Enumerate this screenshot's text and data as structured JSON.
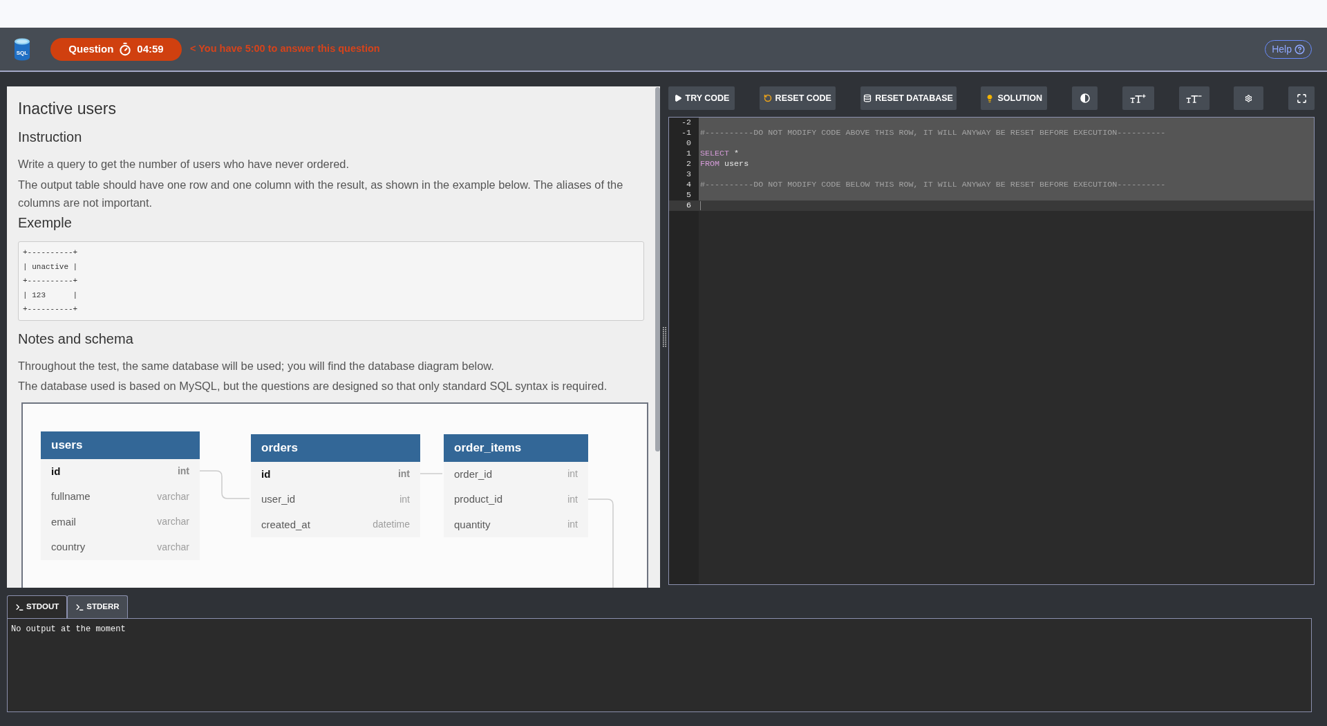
{
  "header": {
    "logo": "SQL",
    "timer": {
      "label": "Question",
      "time": "04:59"
    },
    "notice": "< You have 5:00 to answer this question",
    "help": "Help"
  },
  "problem": {
    "title": "Inactive users",
    "instruction_heading": "Instruction",
    "instruction": [
      "Write a query to get the number of users who have never ordered.",
      "The output table should have one row and one column with the result, as shown in the example below. The aliases of the columns are not important."
    ],
    "example_heading": "Exemple",
    "example": [
      "+----------+",
      "| unactive |",
      "+----------+",
      "| 123      |",
      "+----------+"
    ],
    "notes_heading": "Notes and schema",
    "notes": [
      "Throughout the test, the same database will be used; you will find the database diagram below.",
      "The database used is based on MySQL, but the questions are designed so that only standard SQL syntax is required."
    ],
    "schema": {
      "tables": [
        {
          "name": "users",
          "columns": [
            {
              "name": "id",
              "type": "int",
              "primary": true
            },
            {
              "name": "fullname",
              "type": "varchar",
              "primary": false
            },
            {
              "name": "email",
              "type": "varchar",
              "primary": false
            },
            {
              "name": "country",
              "type": "varchar",
              "primary": false
            }
          ]
        },
        {
          "name": "orders",
          "columns": [
            {
              "name": "id",
              "type": "int",
              "primary": true
            },
            {
              "name": "user_id",
              "type": "int",
              "primary": false
            },
            {
              "name": "created_at",
              "type": "datetime",
              "primary": false
            }
          ]
        },
        {
          "name": "order_items",
          "columns": [
            {
              "name": "order_id",
              "type": "int",
              "primary": false
            },
            {
              "name": "product_id",
              "type": "int",
              "primary": false
            },
            {
              "name": "quantity",
              "type": "int",
              "primary": false
            }
          ]
        }
      ]
    }
  },
  "toolbar": [
    {
      "kind": "try",
      "label": "TRY CODE"
    },
    {
      "kind": "reset_code",
      "label": "RESET CODE"
    },
    {
      "kind": "reset_db",
      "label": "RESET DATABASE"
    },
    {
      "kind": "solution",
      "label": "SOLUTION"
    },
    {
      "kind": "contrast"
    },
    {
      "kind": "font_up"
    },
    {
      "kind": "font_down"
    },
    {
      "kind": "settings"
    },
    {
      "kind": "fullscreen"
    }
  ],
  "editor": {
    "lines": [
      {
        "number": "-2",
        "readonly": true,
        "current": false
      },
      {
        "number": "-1",
        "readonly": true,
        "current": false,
        "tokens": [
          {
            "kind": "comment",
            "text": "#----------DO NOT MODIFY CODE ABOVE THIS ROW, IT WILL ANYWAY BE RESET BEFORE EXECUTION----------"
          }
        ]
      },
      {
        "number": "0",
        "readonly": true,
        "current": false
      },
      {
        "number": "1",
        "readonly": true,
        "current": false,
        "tokens": [
          {
            "kind": "keyword",
            "text": "SELECT"
          },
          {
            "kind": "plain",
            "text": " *"
          }
        ]
      },
      {
        "number": "2",
        "readonly": true,
        "current": false,
        "tokens": [
          {
            "kind": "keyword",
            "text": "FROM"
          },
          {
            "kind": "plain",
            "text": " users"
          }
        ]
      },
      {
        "number": "3",
        "readonly": true,
        "current": false
      },
      {
        "number": "4",
        "readonly": true,
        "current": false,
        "tokens": [
          {
            "kind": "comment",
            "text": "#----------DO NOT MODIFY CODE BELOW THIS ROW, IT WILL ANYWAY BE RESET BEFORE EXECUTION----------"
          }
        ]
      },
      {
        "number": "5",
        "readonly": true,
        "current": false
      },
      {
        "number": "6",
        "readonly": false,
        "current": true
      }
    ]
  },
  "output": {
    "tabs": [
      {
        "label": "STDOUT",
        "selected": true
      },
      {
        "label": "STDERR",
        "selected": false
      }
    ],
    "text": "No output at the moment"
  }
}
